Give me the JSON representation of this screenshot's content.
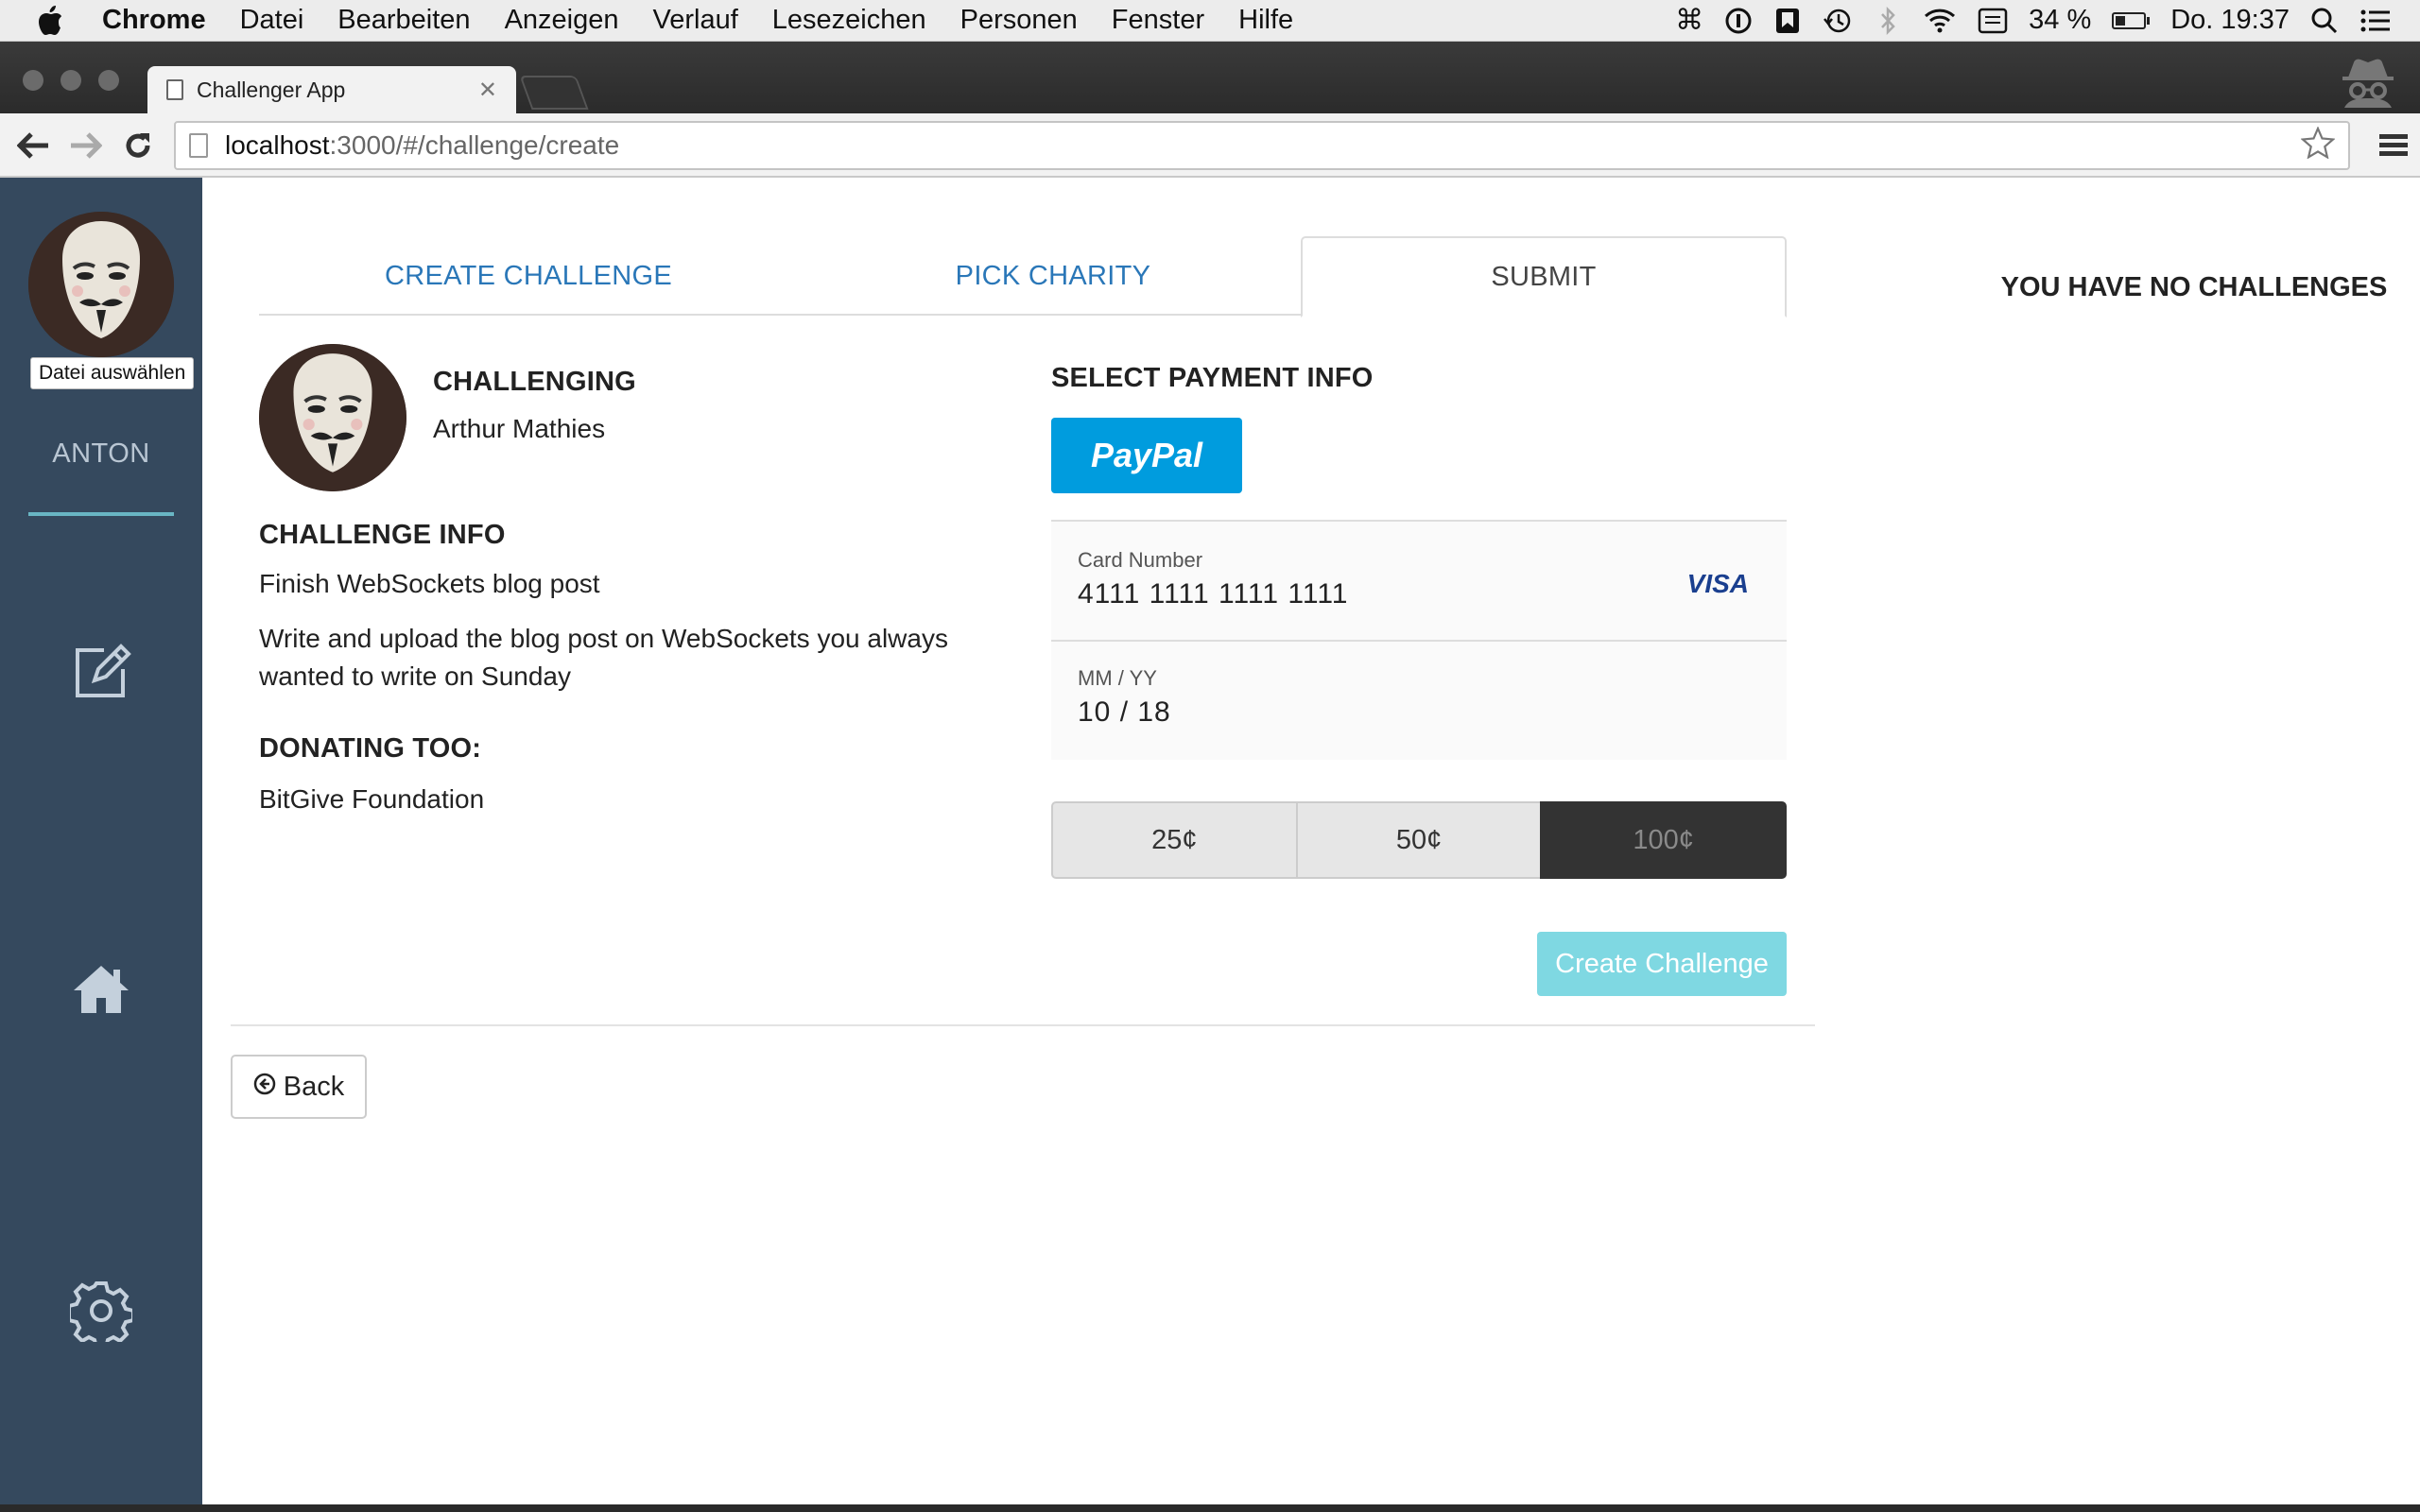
{
  "menubar": {
    "app_name": "Chrome",
    "items": [
      "Datei",
      "Bearbeiten",
      "Anzeigen",
      "Verlauf",
      "Lesezeichen",
      "Personen",
      "Fenster",
      "Hilfe"
    ],
    "battery_text": "34 %",
    "battery_level": 0.34,
    "clock": "Do. 19:37"
  },
  "browser": {
    "tab_title": "Challenger App",
    "url_host": "localhost",
    "url_path": ":3000/#/challenge/create"
  },
  "sidebar": {
    "file_button_label": "Datei auswählen",
    "username": "ANTON",
    "colors": {
      "background": "#35495e",
      "accent": "#69b6c4"
    }
  },
  "steps": {
    "create": "CREATE CHALLENGE",
    "charity": "PICK CHARITY",
    "submit": "SUBMIT"
  },
  "challenges_panel": {
    "empty_text": "YOU HAVE NO CHALLENGES"
  },
  "challenge": {
    "challenging_label": "CHALLENGING",
    "challenged_name": "Arthur Mathies",
    "info_label": "CHALLENGE INFO",
    "title": "Finish WebSockets blog post",
    "description": "Write and upload the blog post on WebSockets you always wanted to write on Sunday",
    "donating_label": "DONATING TOO:",
    "charity": "BitGive Foundation"
  },
  "payment": {
    "heading": "SELECT PAYMENT INFO",
    "paypal_label": "PayPal",
    "card_number_label": "Card Number",
    "card_number": "4111 1111 1111 1111",
    "card_brand": "VISA",
    "expiry_label": "MM / YY",
    "expiry": "10 / 18",
    "amounts": [
      "25¢",
      "50¢",
      "100¢"
    ],
    "selected_amount": "100¢",
    "submit_label": "Create Challenge",
    "colors": {
      "paypal": "#009cde",
      "submit": "#7fd8e2",
      "link": "#2a77b8"
    }
  },
  "back_label": "Back"
}
